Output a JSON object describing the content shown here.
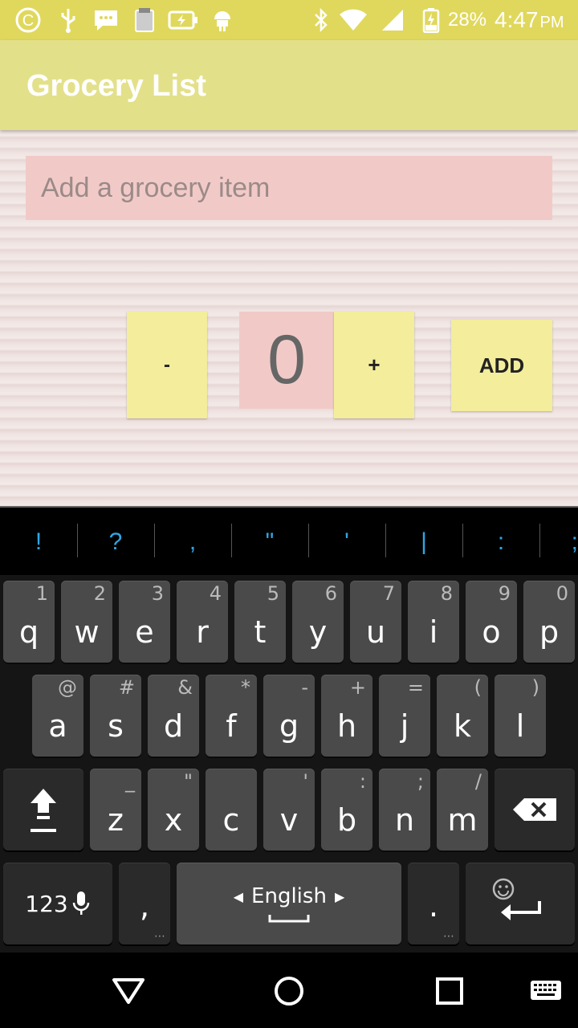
{
  "status_bar": {
    "battery": "28%",
    "time": "4:47",
    "ampm": "PM",
    "icons": [
      "copyright-c-icon",
      "usb-icon",
      "message-icon",
      "app-icon",
      "battery-charging-icon",
      "android-icon",
      "bluetooth-icon",
      "wifi-icon",
      "signal-icon",
      "battery-icon"
    ]
  },
  "app": {
    "title": "Grocery List",
    "item_placeholder": "Add a grocery item",
    "quantity": "0",
    "minus_label": "-",
    "plus_label": "+",
    "add_label": "ADD"
  },
  "suggestions": [
    "!",
    "?",
    ",",
    "\"",
    "'",
    "|",
    ":",
    ";"
  ],
  "keyboard": {
    "row1": [
      {
        "k": "q",
        "h": "1"
      },
      {
        "k": "w",
        "h": "2"
      },
      {
        "k": "e",
        "h": "3"
      },
      {
        "k": "r",
        "h": "4"
      },
      {
        "k": "t",
        "h": "5"
      },
      {
        "k": "y",
        "h": "6"
      },
      {
        "k": "u",
        "h": "7"
      },
      {
        "k": "i",
        "h": "8"
      },
      {
        "k": "o",
        "h": "9"
      },
      {
        "k": "p",
        "h": "0"
      }
    ],
    "row2": [
      {
        "k": "a",
        "h": "@"
      },
      {
        "k": "s",
        "h": "#"
      },
      {
        "k": "d",
        "h": "&"
      },
      {
        "k": "f",
        "h": "*"
      },
      {
        "k": "g",
        "h": "-"
      },
      {
        "k": "h",
        "h": "+"
      },
      {
        "k": "j",
        "h": "="
      },
      {
        "k": "k",
        "h": "("
      },
      {
        "k": "l",
        "h": ")"
      }
    ],
    "row3": [
      {
        "k": "z",
        "h": "_"
      },
      {
        "k": "x",
        "h": "\""
      },
      {
        "k": "c",
        "h": ""
      },
      {
        "k": "v",
        "h": "'"
      },
      {
        "k": "b",
        "h": ":"
      },
      {
        "k": "n",
        "h": ";"
      },
      {
        "k": "m",
        "h": "/"
      }
    ],
    "numbers_label": "123",
    "comma_label": ",",
    "space_label": "English",
    "period_label": "."
  },
  "colors": {
    "status_bar": "#e0d85c",
    "app_bar": "#e3e08a",
    "sticky_yellow": "#f3ed9c",
    "sticky_pink": "#f1cac7",
    "suggestion_blue": "#2ea7e6"
  }
}
